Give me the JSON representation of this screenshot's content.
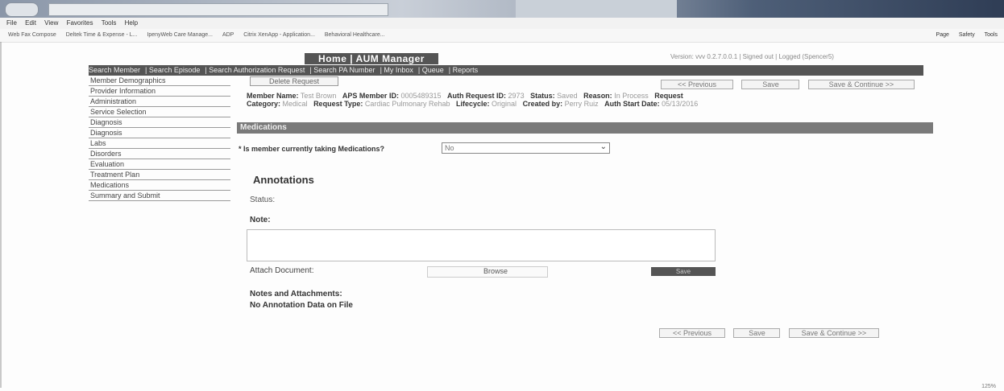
{
  "browser": {
    "menu": [
      "File",
      "Edit",
      "View",
      "Favorites",
      "Tools",
      "Help"
    ],
    "favorites": [
      "Web Fax Compose",
      "Deltek Time & Expense - L...",
      "IpenyWeb Care Manage...",
      "ADP",
      "Citrix XenApp - Application...",
      "Behavioral Healthcare..."
    ],
    "right_tools": [
      "Page",
      "Safety",
      "Tools"
    ],
    "zoom": "125%"
  },
  "app": {
    "title": "Home | AUM Manager",
    "version": "Version: vvv 0.2.7.0.0.1 | Signed out | Logged (Spencer5)"
  },
  "nav": {
    "items": [
      "Search Member",
      "Search Episode",
      "Search Authorization Request",
      "Search PA Number",
      "My Inbox",
      "Queue",
      "Reports"
    ]
  },
  "sidebar": {
    "items": [
      "Member Demographics",
      "Provider Information",
      "Administration",
      "Service Selection",
      "Diagnosis",
      "Diagnosis",
      "Labs",
      "Disorders",
      "Evaluation",
      "Treatment Plan",
      "Medications",
      "Summary and Submit"
    ]
  },
  "toolbar": {
    "delete_label": "Delete Request",
    "previous_label": "<< Previous",
    "save_label": "Save",
    "save_continue_label": "Save & Continue >>"
  },
  "member_info": {
    "name_label": "Member Name:",
    "name_value": "Test Brown",
    "aps_label": "APS Member ID:",
    "aps_value": "0005489315",
    "auth_label": "Auth Request ID:",
    "auth_value": "2973",
    "status_label": "Status:",
    "status_value": "Saved",
    "reason_label": "Reason:",
    "reason_value": "In Process",
    "request_label": "Request",
    "category_label": "Category:",
    "category_value": "Medical",
    "type_label": "Request Type:",
    "type_value": "Cardiac Pulmonary Rehab",
    "lifecycle_label": "Lifecycle:",
    "lifecycle_value": "Original",
    "created_label": "Created by:",
    "created_value": "Perry Ruiz",
    "start_label": "Auth Start Date:",
    "start_value": "05/13/2016"
  },
  "section": {
    "title": "Medications"
  },
  "medications": {
    "question": "* Is member currently taking Medications?",
    "selected": "No"
  },
  "annotations": {
    "heading": "Annotations",
    "status_label": "Status:",
    "note_label": "Note:",
    "attach_label": "Attach Document:",
    "browse_label": "Browse",
    "save_label": "Save",
    "notes_heading": "Notes and Attachments:",
    "no_data": "No Annotation Data on File"
  }
}
